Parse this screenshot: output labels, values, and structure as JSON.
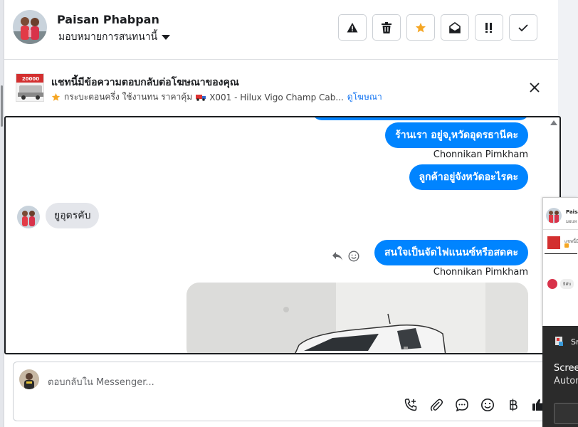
{
  "header": {
    "contact_name": "Paisan Phabpan",
    "assign_label": "มอบหมายการสนทนานี้"
  },
  "ad_banner": {
    "title": "แชทนี้มีข้อความตอบกลับต่อโฆษณาของคุณ",
    "thumb_text": "20000",
    "subtitle": "กระบะตอนครึ่ง ใช้งานทน ราคาคุ้ม",
    "product": "X001 - Hilux Vigo Champ Cab...",
    "link": "ดูโฆษณา"
  },
  "messages": [
    {
      "type": "outgoing",
      "text": "ร้านเรา อยู่จ.ุหวัดอุดรธานีคะ"
    },
    {
      "type": "outgoing",
      "text": "ลูกค้าอยู่จังหวัดอะไรคะ"
    },
    {
      "type": "incoming",
      "text": "ยูอุดรคับ"
    },
    {
      "type": "outgoing",
      "text": "สนใจเป็นจัดไฟแนนซ์หรือสดคะ"
    }
  ],
  "sender_name": "Chonnikan Pimkham",
  "composer": {
    "placeholder": "ตอบกลับใน Messenger..."
  },
  "overlay": {
    "mini_name": "Paisa",
    "mini_sub": "มอบห",
    "mini_ad": "แชทนี้มี",
    "mini_msg": "ยิคับ"
  },
  "popup": {
    "title": "Sn",
    "line1": "Scree",
    "line2": "Autom"
  },
  "colors": {
    "accent": "#0084ff",
    "star": "#f5a623"
  }
}
